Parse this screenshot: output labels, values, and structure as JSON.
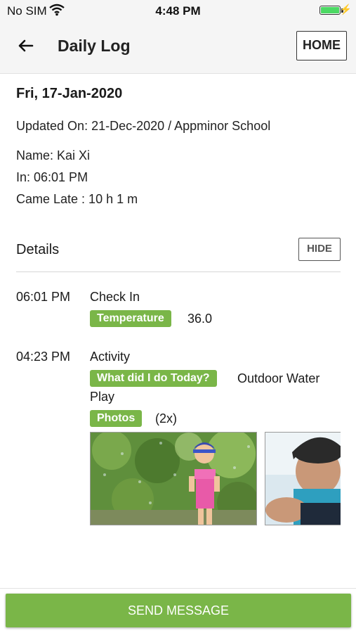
{
  "status_bar": {
    "carrier": "No SIM",
    "time": "4:48 PM"
  },
  "header": {
    "title": "Daily Log",
    "home_label": "HOME"
  },
  "log": {
    "date": "Fri, 17-Jan-2020",
    "updated": "Updated On: 21-Dec-2020 / Appminor School",
    "name": "Name: Kai Xi",
    "in": "In: 06:01 PM",
    "came_late": "Came Late : 10 h 1 m"
  },
  "details": {
    "label": "Details",
    "hide_label": "HIDE"
  },
  "events": [
    {
      "time": "06:01 PM",
      "title": "Check In",
      "tag": "Temperature",
      "value": "36.0"
    },
    {
      "time": "04:23 PM",
      "title": "Activity",
      "tag": "What did I do Today?",
      "value_line1": "Outdoor Water",
      "value_line2": "Play",
      "photos_tag": "Photos",
      "photos_count": "(2x)"
    }
  ],
  "footer": {
    "send_label": "SEND MESSAGE"
  },
  "colors": {
    "accent_green": "#7ab648",
    "header_bg": "#f5f5f5"
  }
}
